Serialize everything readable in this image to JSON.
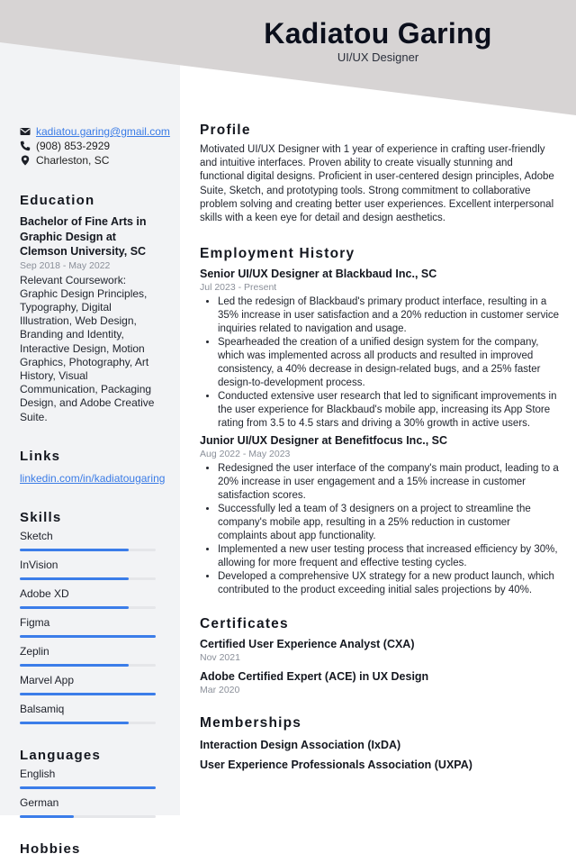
{
  "header": {
    "name": "Kadiatou Garing",
    "role": "UI/UX Designer",
    "colors": {
      "header_bg": "#d7d4d4",
      "sidebar_bg": "#f2f3f5",
      "accent": "#3b7de9"
    }
  },
  "contact": {
    "email": {
      "icon": "envelope-icon",
      "value": "kadiatou.garing@gmail.com"
    },
    "phone": {
      "icon": "phone-icon",
      "value": "(908) 853-2929"
    },
    "location": {
      "icon": "map-pin-icon",
      "value": "Charleston, SC"
    }
  },
  "education": {
    "heading": "Education",
    "degree": "Bachelor of Fine Arts in Graphic Design at Clemson University, SC",
    "dates": "Sep 2018 - May 2022",
    "description": "Relevant Coursework: Graphic Design Principles, Typography, Digital Illustration, Web Design, Branding and Identity, Interactive Design, Motion Graphics, Photography, Art History, Visual Communication, Packaging Design, and Adobe Creative Suite."
  },
  "links": {
    "heading": "Links",
    "items": [
      {
        "label": "linkedin.com/in/kadiatougaring"
      }
    ]
  },
  "skills": {
    "heading": "Skills",
    "items": [
      {
        "label": "Sketch",
        "level": 0.8
      },
      {
        "label": "InVision",
        "level": 0.8
      },
      {
        "label": "Adobe XD",
        "level": 0.8
      },
      {
        "label": "Figma",
        "level": 1.0
      },
      {
        "label": "Zeplin",
        "level": 0.8
      },
      {
        "label": "Marvel App",
        "level": 1.0
      },
      {
        "label": "Balsamiq",
        "level": 0.8
      }
    ]
  },
  "languages": {
    "heading": "Languages",
    "items": [
      {
        "label": "English",
        "level": 1.0
      },
      {
        "label": "German",
        "level": 0.4
      }
    ]
  },
  "hobbies": {
    "heading": "Hobbies"
  },
  "profile": {
    "heading": "Profile",
    "text": "Motivated UI/UX Designer with 1 year of experience in crafting user-friendly and intuitive interfaces. Proven ability to create visually stunning and functional digital designs. Proficient in user-centered design principles, Adobe Suite, Sketch, and prototyping tools. Strong commitment to collaborative problem solving and creating better user experiences. Excellent interpersonal skills with a keen eye for detail and design aesthetics."
  },
  "employment": {
    "heading": "Employment History",
    "jobs": [
      {
        "title": "Senior UI/UX Designer at Blackbaud Inc., SC",
        "dates": "Jul 2023 - Present",
        "bullets": [
          "Led the redesign of Blackbaud's primary product interface, resulting in a 35% increase in user satisfaction and a 20% reduction in customer service inquiries related to navigation and usage.",
          "Spearheaded the creation of a unified design system for the company, which was implemented across all products and resulted in improved consistency, a 40% decrease in design-related bugs, and a 25% faster design-to-development process.",
          "Conducted extensive user research that led to significant improvements in the user experience for Blackbaud's mobile app, increasing its App Store rating from 3.5 to 4.5 stars and driving a 30% growth in active users."
        ]
      },
      {
        "title": "Junior UI/UX Designer at Benefitfocus Inc., SC",
        "dates": "Aug 2022 - May 2023",
        "bullets": [
          "Redesigned the user interface of the company's main product, leading to a 20% increase in user engagement and a 15% increase in customer satisfaction scores.",
          "Successfully led a team of 3 designers on a project to streamline the company's mobile app, resulting in a 25% reduction in customer complaints about app functionality.",
          "Implemented a new user testing process that increased efficiency by 30%, allowing for more frequent and effective testing cycles.",
          "Developed a comprehensive UX strategy for a new product launch, which contributed to the product exceeding initial sales projections by 40%."
        ]
      }
    ]
  },
  "certificates": {
    "heading": "Certificates",
    "items": [
      {
        "title": "Certified User Experience Analyst (CXA)",
        "date": "Nov 2021"
      },
      {
        "title": "Adobe Certified Expert (ACE) in UX Design",
        "date": "Mar 2020"
      }
    ]
  },
  "memberships": {
    "heading": "Memberships",
    "items": [
      "Interaction Design Association (IxDA)",
      "User Experience Professionals Association (UXPA)"
    ]
  }
}
